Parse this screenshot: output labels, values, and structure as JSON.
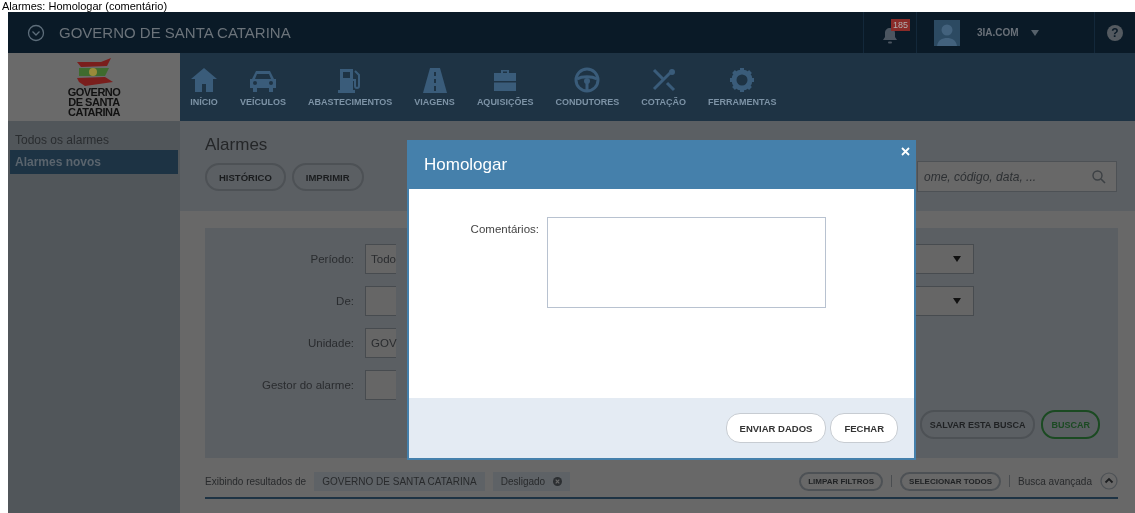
{
  "caption": "Alarmes: Homologar (comentário)",
  "topbar": {
    "title": "GOVERNO DE SANTA CATARINA",
    "notifications": "185",
    "user": "3IA.COM",
    "help": "?"
  },
  "logo": {
    "lines": [
      "GOVERNO",
      "DE SANTA",
      "CATARINA"
    ]
  },
  "nav": [
    {
      "label": "INÍCIO",
      "kind": "home"
    },
    {
      "label": "VEÍCULOS",
      "kind": "car"
    },
    {
      "label": "ABASTECIMENTOS",
      "kind": "fuel"
    },
    {
      "label": "VIAGENS",
      "kind": "road"
    },
    {
      "label": "AQUISIÇÕES",
      "kind": "bag"
    },
    {
      "label": "CONDUTORES",
      "kind": "wheel"
    },
    {
      "label": "COTAÇÃO",
      "kind": "tools"
    },
    {
      "label": "FERRAMENTAS",
      "kind": "gear"
    }
  ],
  "sidebar": {
    "items": [
      {
        "label": "Todos os alarmes",
        "selected": false
      },
      {
        "label": "Alarmes novos",
        "selected": true
      }
    ]
  },
  "page": {
    "title": "Alarmes",
    "buttons": [
      "HISTÓRICO",
      "IMPRIMIR"
    ],
    "search": {
      "placeholder": "ome, código, data, ..."
    }
  },
  "filters": {
    "rows": [
      {
        "label": "Período:",
        "value": "Todo",
        "has_right_field": true
      },
      {
        "label": "De:",
        "has_right_field": true
      },
      {
        "label": "Unidade:",
        "value": "GOV",
        "has_right_field": false
      },
      {
        "label": "Gestor do alarme:",
        "has_right_field": false
      }
    ],
    "buttons": [
      {
        "label": "SALVAR ESTA BUSCA",
        "kind": "default"
      },
      {
        "label": "BUSCAR",
        "kind": "primary"
      }
    ]
  },
  "results": {
    "prefix": "Exibindo resultados de",
    "chips": [
      {
        "label": "GOVERNO DE SANTA CATARINA",
        "removable": false
      },
      {
        "label": "Desligado",
        "removable": true
      }
    ],
    "actions": [
      "LIMPAR FILTROS",
      "SELECIONAR TODOS"
    ],
    "advanced": "Busca avançada"
  },
  "dialog": {
    "title": "Homologar",
    "field_label": "Comentários:",
    "buttons": [
      "ENVIAR DADOS",
      "FECHAR"
    ]
  }
}
